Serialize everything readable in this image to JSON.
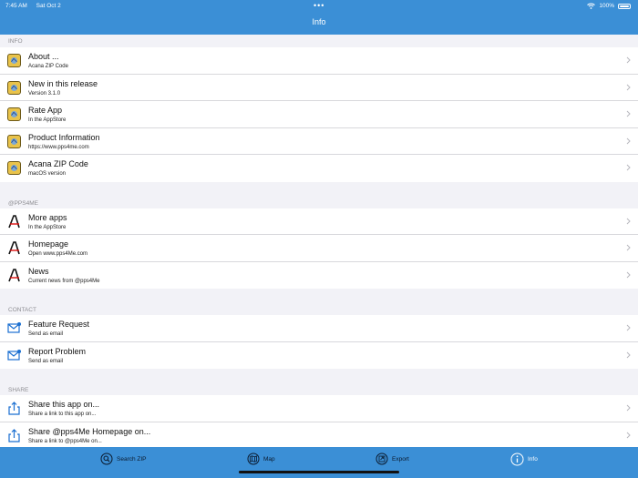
{
  "status_bar": {
    "time": "7:45 AM",
    "date": "Sat Oct 2",
    "battery": "100%"
  },
  "nav": {
    "title": "Info"
  },
  "sections": [
    {
      "header": "INFO",
      "rows": [
        {
          "label": "About ...",
          "sub": "Acana ZIP Code",
          "icon": "app-icon"
        },
        {
          "label": "New in this release",
          "sub": "Version 3.1.0",
          "icon": "app-icon"
        },
        {
          "label": "Rate App",
          "sub": "In the AppStore",
          "icon": "app-icon"
        },
        {
          "label": "Product Information",
          "sub": "https://www.pps4me.com",
          "icon": "app-icon"
        },
        {
          "label": "Acana ZIP Code",
          "sub": "macOS version",
          "icon": "app-icon"
        }
      ]
    },
    {
      "header": "@PPS4ME",
      "rows": [
        {
          "label": "More apps",
          "sub": "In the AppStore",
          "icon": "pps-logo-icon"
        },
        {
          "label": "Homepage",
          "sub": "Open www.pps4Me.com",
          "icon": "pps-logo-icon"
        },
        {
          "label": "News",
          "sub": "Current news from @pps4Me",
          "icon": "pps-logo-icon"
        }
      ]
    },
    {
      "header": "CONTACT",
      "rows": [
        {
          "label": "Feature Request",
          "sub": "Send as email",
          "icon": "mail-icon"
        },
        {
          "label": "Report Problem",
          "sub": "Send as email",
          "icon": "mail-icon"
        }
      ]
    },
    {
      "header": "SHARE",
      "rows": [
        {
          "label": "Share this app on...",
          "sub": "Share a link to this app on...",
          "icon": "share-icon"
        },
        {
          "label": "Share @pps4Me Homepage on...",
          "sub": "Share a link to @pps4Me on...",
          "icon": "share-icon"
        }
      ]
    }
  ],
  "tabs": [
    {
      "label": "Search ZIP",
      "icon": "search-icon"
    },
    {
      "label": "Map",
      "icon": "map-icon"
    },
    {
      "label": "Export",
      "icon": "export-icon"
    },
    {
      "label": "Info",
      "icon": "info-icon"
    }
  ],
  "colors": {
    "accent": "#3b8fd6",
    "background": "#f2f2f7",
    "tab_selected": "#ffffff",
    "tab_unselected": "#0b1a2e"
  }
}
